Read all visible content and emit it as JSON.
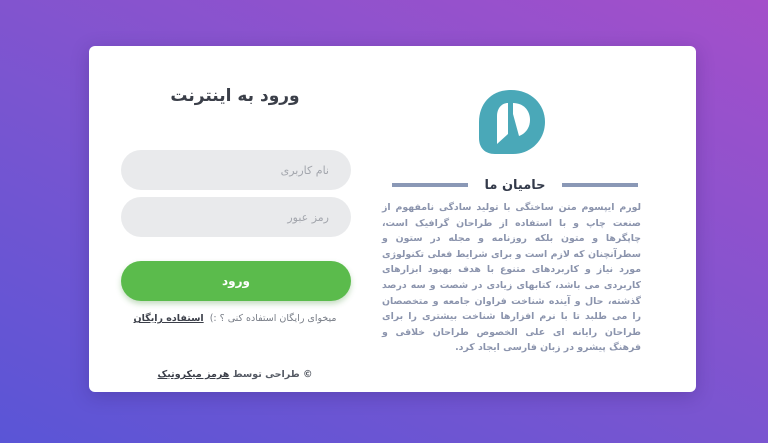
{
  "sponsors": {
    "title": "حامیان ما",
    "logo_icon": "chat-bubble-logo-icon",
    "logo_color": "#4aa8b8",
    "text": "لورم ایپسوم متن ساختگی با تولید سادگی نامفهوم از صنعت چاپ و با استفاده از طراحان گرافیک است، چاپگرها و متون بلکه روزنامه و مجله در ستون و سطرآنچنان که لازم است و برای شرایط فعلی تکنولوژی مورد نیاز و کاربردهای متنوع با هدف بهبود ابزارهای کاربردی می باشد، کتابهای زیادی در شصت و سه درصد گذشته، حال و آینده شناخت فراوان جامعه و متخصصان را می طلبد تا با نرم افزارها شناخت بیشتری را برای طراحان رایانه ای علی الخصوص طراحان خلاقی و فرهنگ پیشرو در زبان فارسی ایجاد کرد."
  },
  "login": {
    "title": "ورود به اینترنت",
    "username_placeholder": "نام کاربری",
    "password_placeholder": "رمز عبور",
    "submit_label": "ورود",
    "free_prompt": "میخوای رایگان استفاده کنی ؟ :)",
    "free_link": "استفاده رایگان",
    "credit_prefix": "© طراحی توسط",
    "credit_link": "هرمز میکروتیک"
  },
  "colors": {
    "accent_green": "#5bbb4c",
    "logo_teal": "#4aa8b8",
    "divider": "#8a98b6"
  }
}
